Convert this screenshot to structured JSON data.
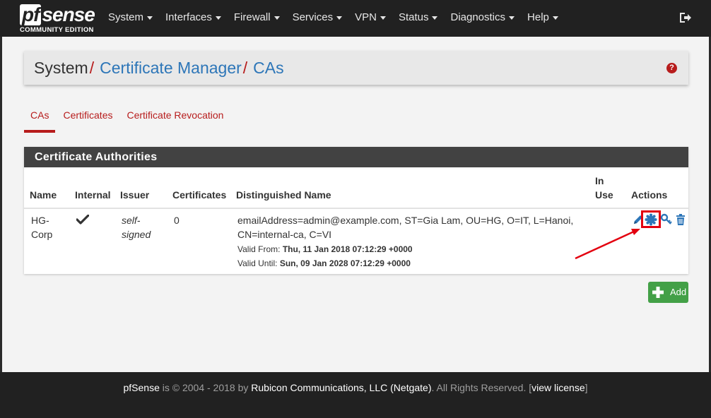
{
  "brand": {
    "logo_pf": "pf",
    "logo_sense": "sense",
    "edition": "COMMUNITY EDITION"
  },
  "nav": {
    "items": [
      {
        "label": "System"
      },
      {
        "label": "Interfaces"
      },
      {
        "label": "Firewall"
      },
      {
        "label": "Services"
      },
      {
        "label": "VPN"
      },
      {
        "label": "Status"
      },
      {
        "label": "Diagnostics"
      },
      {
        "label": "Help"
      }
    ],
    "logout_icon": "sign-out-icon"
  },
  "breadcrumb": {
    "root": "System",
    "section": "Certificate Manager",
    "page": "CAs",
    "separator": "/",
    "help_icon": "question-circle-icon"
  },
  "tabs": [
    {
      "label": "CAs",
      "active": true
    },
    {
      "label": "Certificates",
      "active": false
    },
    {
      "label": "Certificate Revocation",
      "active": false
    }
  ],
  "panel": {
    "title": "Certificate Authorities",
    "columns": {
      "name": "Name",
      "internal": "Internal",
      "issuer": "Issuer",
      "certificates": "Certificates",
      "dn": "Distinguished Name",
      "in_use_1": "In",
      "in_use_2": "Use",
      "actions": "Actions"
    },
    "rows": [
      {
        "name_1": "HG-",
        "name_2": "Corp",
        "internal": true,
        "issuer_1": "self-",
        "issuer_2": "signed",
        "certificates": "0",
        "dn_1": "emailAddress=admin@example.com, ST=Gia Lam, OU=HG, O=IT, L=Hanoi,",
        "dn_2": "CN=internal-ca, C=VI",
        "valid_from_label": "Valid From:",
        "valid_from": "Thu, 11 Jan 2018 07:12:29 +0000",
        "valid_until_label": "Valid Until:",
        "valid_until": "Sun, 09 Jan 2028 07:12:29 +0000",
        "in_use": "",
        "actions": [
          "edit-icon",
          "certificate-icon",
          "key-icon",
          "trash-icon"
        ]
      }
    ]
  },
  "add_button": {
    "label": "Add",
    "icon": "plus-icon"
  },
  "footer": {
    "product": "pfSense",
    "is_copyright": "is © 2004 - 2018 by",
    "company": "Rubicon Communications, LLC (Netgate)",
    "rights": ". All Rights Reserved. [",
    "license_link": "view license",
    "close_bracket": "]"
  },
  "colors": {
    "navbar": "#212121",
    "accent_red": "#b71c1c",
    "link_blue": "#2d76b8",
    "panel_header": "#424242",
    "add_green": "#43a047",
    "annotation_red": "#e3000f"
  }
}
